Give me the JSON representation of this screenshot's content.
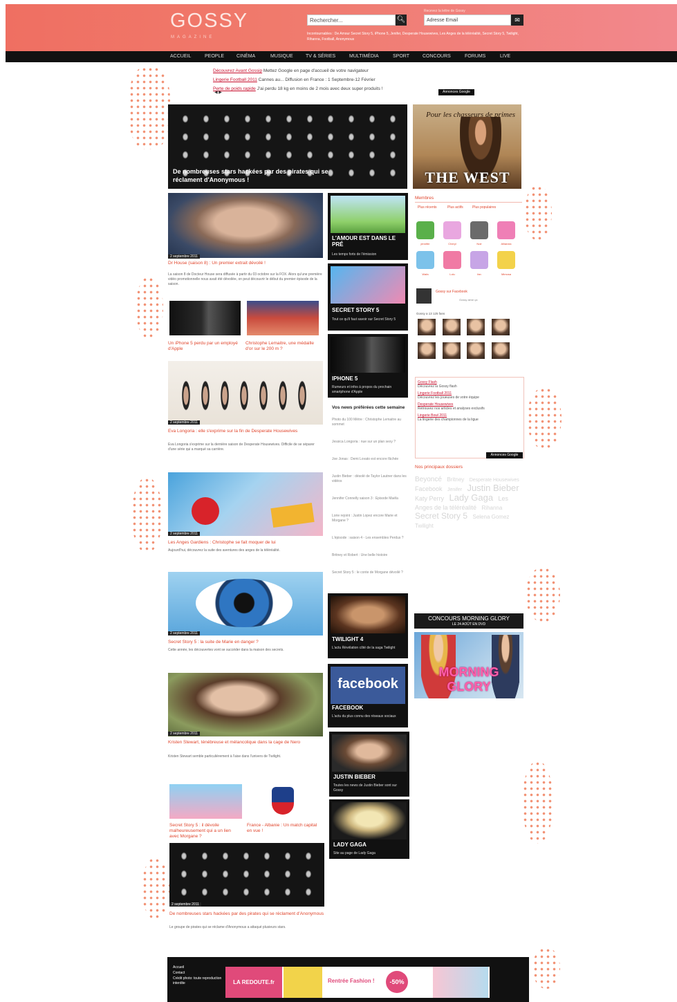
{
  "brand": {
    "logo": "GOSSY",
    "logo_sub": "MAGAZINE"
  },
  "header": {
    "search_placeholder": "Rechercher...",
    "newsletter_label": "Recevez la lettre de Gossy",
    "email_placeholder": "Adresse Email",
    "hot_links": "Incontournables : De Amour Secret Story 5, iPhone 5, Jenifer, Desperate Housewives, Les Anges de la téléréalité, Secret Story 5, Twilight, Rihanna, Football, Anonymous"
  },
  "nav": [
    "ACCUEIL",
    "PEOPLE",
    "CINÉMA",
    "MUSIQUE",
    "TV & SÉRIES",
    "MULTIMÉDIA",
    "SPORT",
    "CONCOURS",
    "FORUMS",
    "LIVE"
  ],
  "adlinks": {
    "items": [
      {
        "title": "Découvrez Avant Gossip",
        "text": "Mettez Google en page d'accueil de votre navigateur"
      },
      {
        "title": "Lingerie Football 2011",
        "text": "Cannes au... Diffusion en France : 1 Septembre-12 Février"
      },
      {
        "title": "Perte de poids rapide",
        "text": "J'ai perdu 18 kg en moins de 2 mois avec deux super produits !"
      }
    ],
    "badge": "Annonces Google"
  },
  "hero": {
    "title": "De nombreuses stars hackées par des pirates qui se réclament d'Anonymous !"
  },
  "thewest": {
    "tagline": "Pour les chasseurs de primes",
    "title": "THE WEST"
  },
  "articles": [
    {
      "date": "2 septembre 2011",
      "title": "Dr House (saison 8) : Un premier extrait dévoilé !",
      "text": "La saison 8 de Docteur House sera diffusée à partir du 03 octobre sur la FOX. Alors qu'une première vidéo promotionnelle nous avait été dévoilée, on peut découvrir le début du premier épisode de la saison."
    },
    {
      "title": "Un iPhone 5 perdu par un employé d'Apple"
    },
    {
      "title": "Christophe Lemaitre, une médaille d'or sur le 200 m ?"
    },
    {
      "date": "2 septembre 2011",
      "title": "Eva Longoria : elle s'exprime sur la fin de Desperate Housewives",
      "text": "Eva Longoria s'exprime sur la dernière saison de Desperate Housewives. Difficile de se séparer d'une série qui a marqué sa carrière."
    },
    {
      "date": "2 septembre 2011",
      "title": "Les Anges Gardiens : Christophe se fait moquer de lui",
      "text": "Aujourd'hui, découvrez la suite des aventures des anges de la téléréalité."
    },
    {
      "date": "2 septembre 2011",
      "title": "Secret Story 5 : la suite de Marie en danger ?",
      "text": "Cette année, les découvertes vont se succéder dans la maison des secrets."
    },
    {
      "date": "2 septembre 2011",
      "title": "Kristen Stewart, ténébreuse et mélancolique dans la cage de Nero",
      "text": "Kristen Stewart semble particulièrement à l'aise dans l'univers de Twilight."
    },
    {
      "title": "Secret Story 5 : il dévoile malheureusement qui a un lien avec Morgane ?"
    },
    {
      "title": "France - Albanie : Un match capital en vue !"
    },
    {
      "date": "2 septembre 2011",
      "title": "De nombreuses stars hackées par des pirates qui se réclament d'Anonymous",
      "text": "Le groupe de pirates qui se réclame d'Anonymous a attaqué plusieurs stars."
    }
  ],
  "cards": [
    {
      "title": "L'AMOUR EST DANS LE PRÉ",
      "sub": "Les temps forts de l'émission"
    },
    {
      "title": "SECRET STORY 5",
      "sub": "Tout ce qu'il faut savoir sur Secret Story 5"
    },
    {
      "title": "IPHONE 5",
      "sub": "Rumeurs et infos à propos du prochain smartphone d'Apple"
    },
    {
      "title": "TWILIGHT 4",
      "sub": "L'actu Révélation côté de la saga Twilight"
    },
    {
      "title": "FACEBOOK",
      "sub": "L'actu du plus connu des réseaux sociaux"
    },
    {
      "title": "JUSTIN BIEBER",
      "sub": "Toutes les news de Justin Bieber sont sur Gossy"
    },
    {
      "title": "LADY GAGA",
      "sub": "Site au page de Lady Gaga"
    }
  ],
  "mid_list": {
    "heading": "Vos news préférées cette semaine",
    "items": [
      "Photo du 100 Mètre : Christophe Lemaitre au sommet",
      "Jessica Longoria : nue sur un plan sexy ?",
      "Joe Jonas : Demi Lovato est encore fâchée",
      "Justin Bieber : désolé de Taylor Lautner dans les vidéos",
      "Jennifer Connelly saison 3 : Episode Maëla",
      "Lorie rejoint : Justin Lopez encore Marie et Morgane ?",
      "L'épisode : saison 4 - Les ensembles Perdus ?",
      "Britney et Robert : Une belle histoire",
      "Secret Story 5 : le conte de Morgane dévoilé ?"
    ]
  },
  "sidebar": {
    "members_head": "Membres",
    "tabs": [
      "Plus récents",
      "Plus actifs",
      "Plus populaires"
    ],
    "member_names": [
      "jennifer",
      "Cheryl",
      "Noir",
      "Allianxia",
      "Wafa",
      "Lolu",
      "fan",
      "Mimosa"
    ],
    "member_colors": [
      "#5ab04a",
      "#e9a7e0",
      "#6b6b6b",
      "#ef7fb6",
      "#7cc2ea",
      "#f07aa4",
      "#c7a5e6",
      "#f3d24a"
    ],
    "gossy_label": "Gossy sur Facebook",
    "gossy_sub": "Gossy aime ça",
    "fans_line": "Gossy a 13 125 fans",
    "ad_entries": [
      {
        "title": "Gossy Flash",
        "text": "Découvrez la Gossy flash"
      },
      {
        "title": "Lingerie Football 2011",
        "text": "Découvrez les joueuses de votre équipe"
      },
      {
        "title": "Desperate Housewives",
        "text": "Retrouvez nos articles et analyses exclusifs"
      },
      {
        "title": "Lingerie Bowl 2011",
        "text": "La lingerie des championnes de la ligue"
      }
    ],
    "ad_badge": "Annonces Google",
    "tags_head": "Nos principaux dossiers",
    "tags": [
      "Beyoncé",
      "Britney",
      "Desperate Housewives",
      "Facebook",
      "Jenifer",
      "Justin Bieber",
      "Katy Perry",
      "Lady Gaga",
      "Les Anges de la téléréalité",
      "Rihanna",
      "Secret Story 5",
      "Selena Gomez",
      "Twilight"
    ],
    "contest_head": "CONCOURS MORNING GLORY",
    "contest_sub": "LE 24 AOÛT EN DVD",
    "contest_title": "MORNING GLORY"
  },
  "footer": {
    "links": [
      "Accueil",
      "Contact",
      "Crédit photo: toute reproduction interdite"
    ],
    "ad_brand": "LA REDOUTE.fr",
    "ad_slogan": "Rentrée Fashion !",
    "ad_discount": "-50%"
  }
}
